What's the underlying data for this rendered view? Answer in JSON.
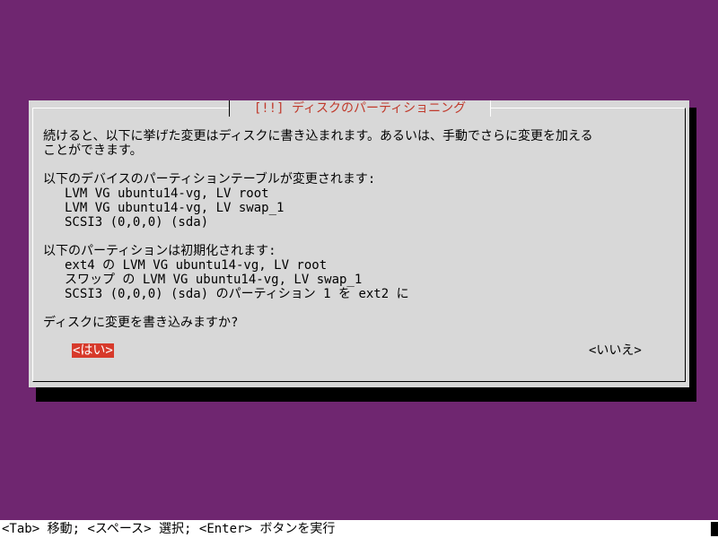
{
  "dialog": {
    "title": "[!!] ディスクのパーティショニング",
    "intro_lines": [
      "続けると、以下に挙げた変更はディスクに書き込まれます。あるいは、手動でさらに変更を加える",
      "ことができます。"
    ],
    "tables_heading": "以下のデバイスのパーティションテーブルが変更されます:",
    "tables": [
      "LVM VG ubuntu14-vg, LV root",
      "LVM VG ubuntu14-vg, LV swap_1",
      "SCSI3 (0,0,0) (sda)"
    ],
    "format_heading": "以下のパーティションは初期化されます:",
    "format": [
      "ext4 の LVM VG ubuntu14-vg, LV root",
      "スワップ の LVM VG ubuntu14-vg, LV swap_1",
      "SCSI3 (0,0,0) (sda) のパーティション 1 を ext2 に"
    ],
    "question": "ディスクに変更を書き込みますか?",
    "yes_label": "<はい>",
    "no_label": "<いいえ>"
  },
  "status_bar": {
    "text": "<Tab> 移動; <スペース> 選択; <Enter> ボタンを実行"
  },
  "colors": {
    "background": "#6f2670",
    "dialog": "#d8d8d8",
    "title_text": "#c0392b",
    "selected_button": "#d73a2b"
  }
}
